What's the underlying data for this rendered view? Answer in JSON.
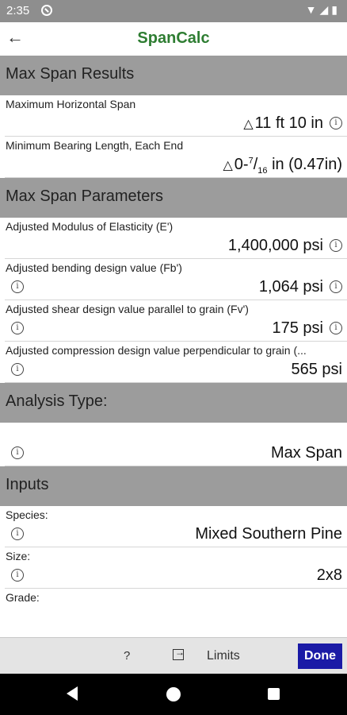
{
  "status_bar": {
    "time": "2:35",
    "icons": "▼◢▮"
  },
  "app_bar": {
    "title": "SpanCalc",
    "back_glyph": "←"
  },
  "results": {
    "header": "Max Span Results",
    "max_span_label": "Maximum Horizontal Span",
    "max_span_value": "11 ft 10 in",
    "min_bearing_label": "Minimum Bearing Length, Each End",
    "min_bearing_value_prefix": "0-",
    "min_bearing_num": "7",
    "min_bearing_den": "16",
    "min_bearing_value_suffix": "in (0.47in)"
  },
  "parameters": {
    "header": "Max Span Parameters",
    "modulus_label": "Adjusted Modulus of Elasticity (E')",
    "modulus_value": "1,400,000 psi",
    "bending_label": "Adjusted bending design value (Fb')",
    "bending_value": "1,064 psi",
    "shear_label": "Adjusted shear design value parallel to grain (Fv')",
    "shear_value": "175 psi",
    "compression_label": "Adjusted compression design value perpendicular to grain (...",
    "compression_value": "565 psi"
  },
  "analysis": {
    "header": "Analysis Type:",
    "value": "Max Span"
  },
  "inputs": {
    "header": "Inputs",
    "species_label": "Species:",
    "species_value": "Mixed Southern Pine",
    "size_label": "Size:",
    "size_value": "2x8",
    "grade_label": "Grade:"
  },
  "bottom_bar": {
    "help_glyph": "?",
    "limits_label": "Limits",
    "done_label": "Done"
  },
  "icons": [
    "back-arrow-icon",
    "warning-triangle-icon",
    "info-icon",
    "help-icon",
    "export-icon"
  ]
}
